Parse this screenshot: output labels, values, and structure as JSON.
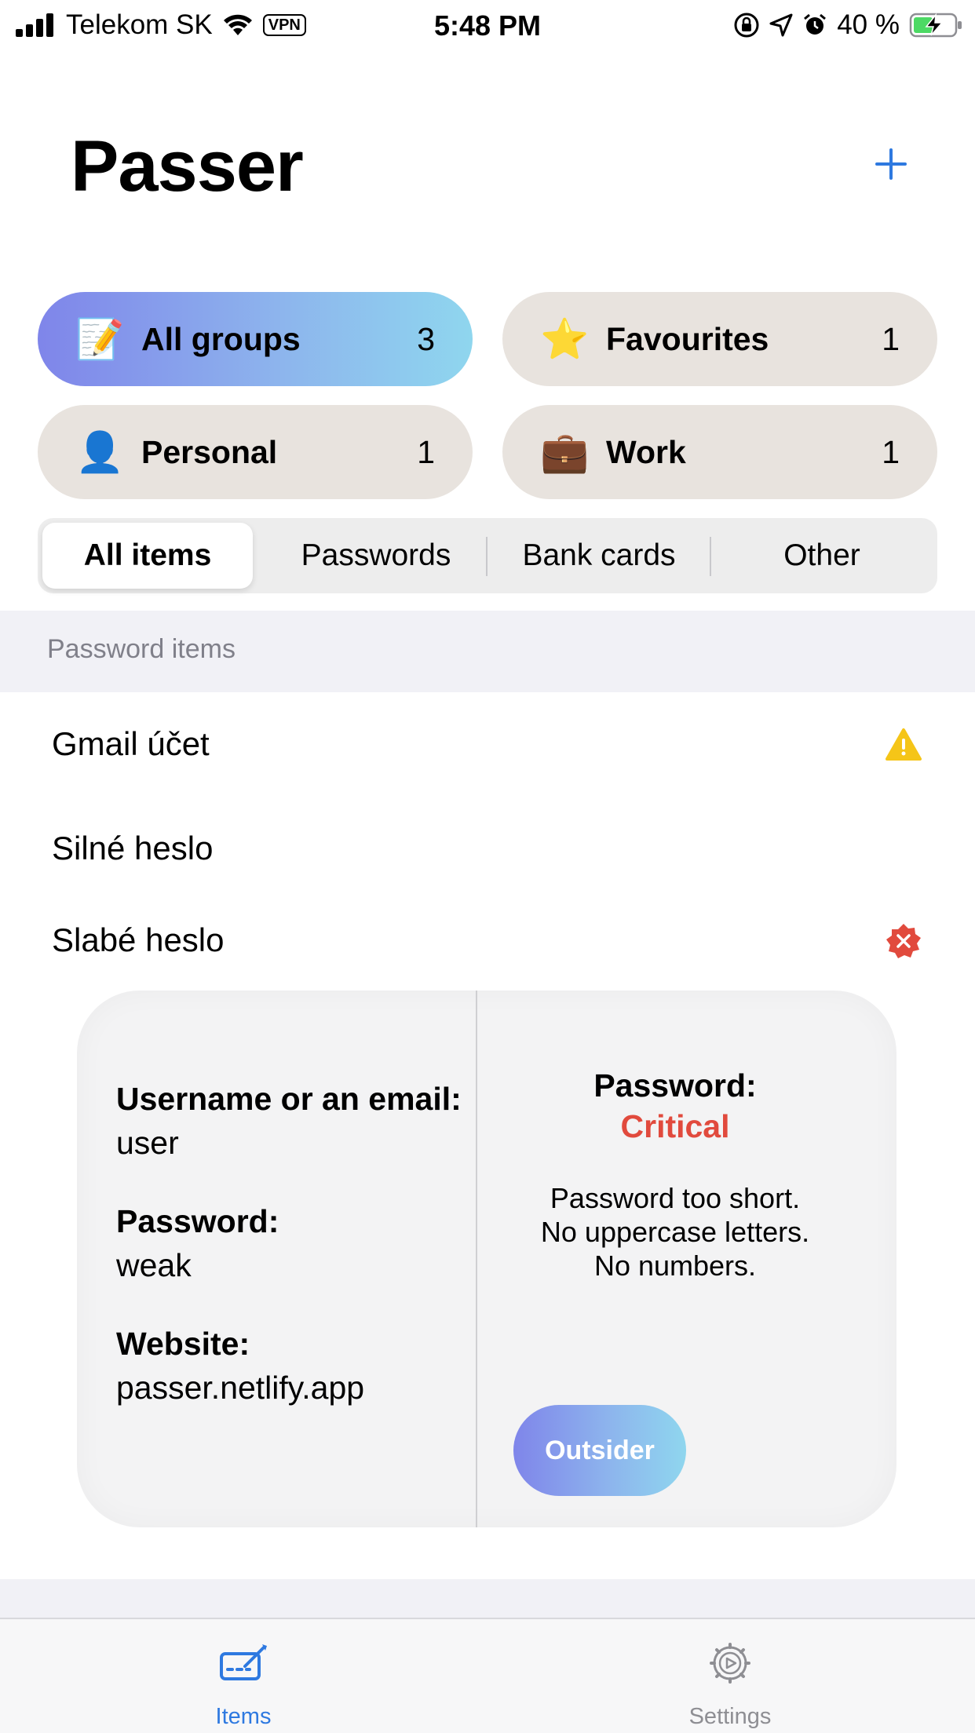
{
  "status_bar": {
    "carrier": "Telekom SK",
    "vpn": "VPN",
    "time": "5:48 PM",
    "battery": "40 %",
    "icons": [
      "signal-icon",
      "wifi-icon",
      "orientation-lock-icon",
      "location-icon",
      "alarm-icon",
      "battery-charging-icon"
    ]
  },
  "header": {
    "title": "Passer",
    "add_icon": "plus-icon"
  },
  "groups": [
    {
      "icon": "📝",
      "label": "All groups",
      "count": "3",
      "active": true
    },
    {
      "icon": "⭐",
      "label": "Favourites",
      "count": "1",
      "active": false
    },
    {
      "icon": "👤",
      "label": "Personal",
      "count": "1",
      "active": false
    },
    {
      "icon": "💼",
      "label": "Work",
      "count": "1",
      "active": false
    }
  ],
  "filter_tabs": [
    "All items",
    "Passwords",
    "Bank cards",
    "Other"
  ],
  "filter_selected": "All items",
  "section": {
    "header": "Password items"
  },
  "items": [
    {
      "label": "Gmail účet",
      "status": "warning-icon"
    },
    {
      "label": "Silné heslo",
      "status": ""
    },
    {
      "label": "Slabé heslo",
      "status": "critical-error-icon"
    }
  ],
  "detail": {
    "username_label": "Username or an email:",
    "username_value": "user",
    "password_label": "Password:",
    "password_value": "weak",
    "website_label": "Website:",
    "website_value": "passer.netlify.app",
    "strength_title": "Password:",
    "strength_level": "Critical",
    "issues": [
      "Password too short.",
      "No uppercase letters.",
      "No numbers."
    ],
    "action_button": "Outsider"
  },
  "tab_bar": {
    "items": [
      {
        "label": "Items",
        "icon": "items-icon",
        "active": true
      },
      {
        "label": "Settings",
        "icon": "gear-icon",
        "active": false
      }
    ]
  },
  "colors": {
    "accent": "#2e79e0",
    "critical": "#e14a3d",
    "warning": "#f5c518",
    "pill_gradient_start": "#7f85ea",
    "pill_gradient_end": "#8fd6ee",
    "pill_neutral": "#e8e3de"
  }
}
